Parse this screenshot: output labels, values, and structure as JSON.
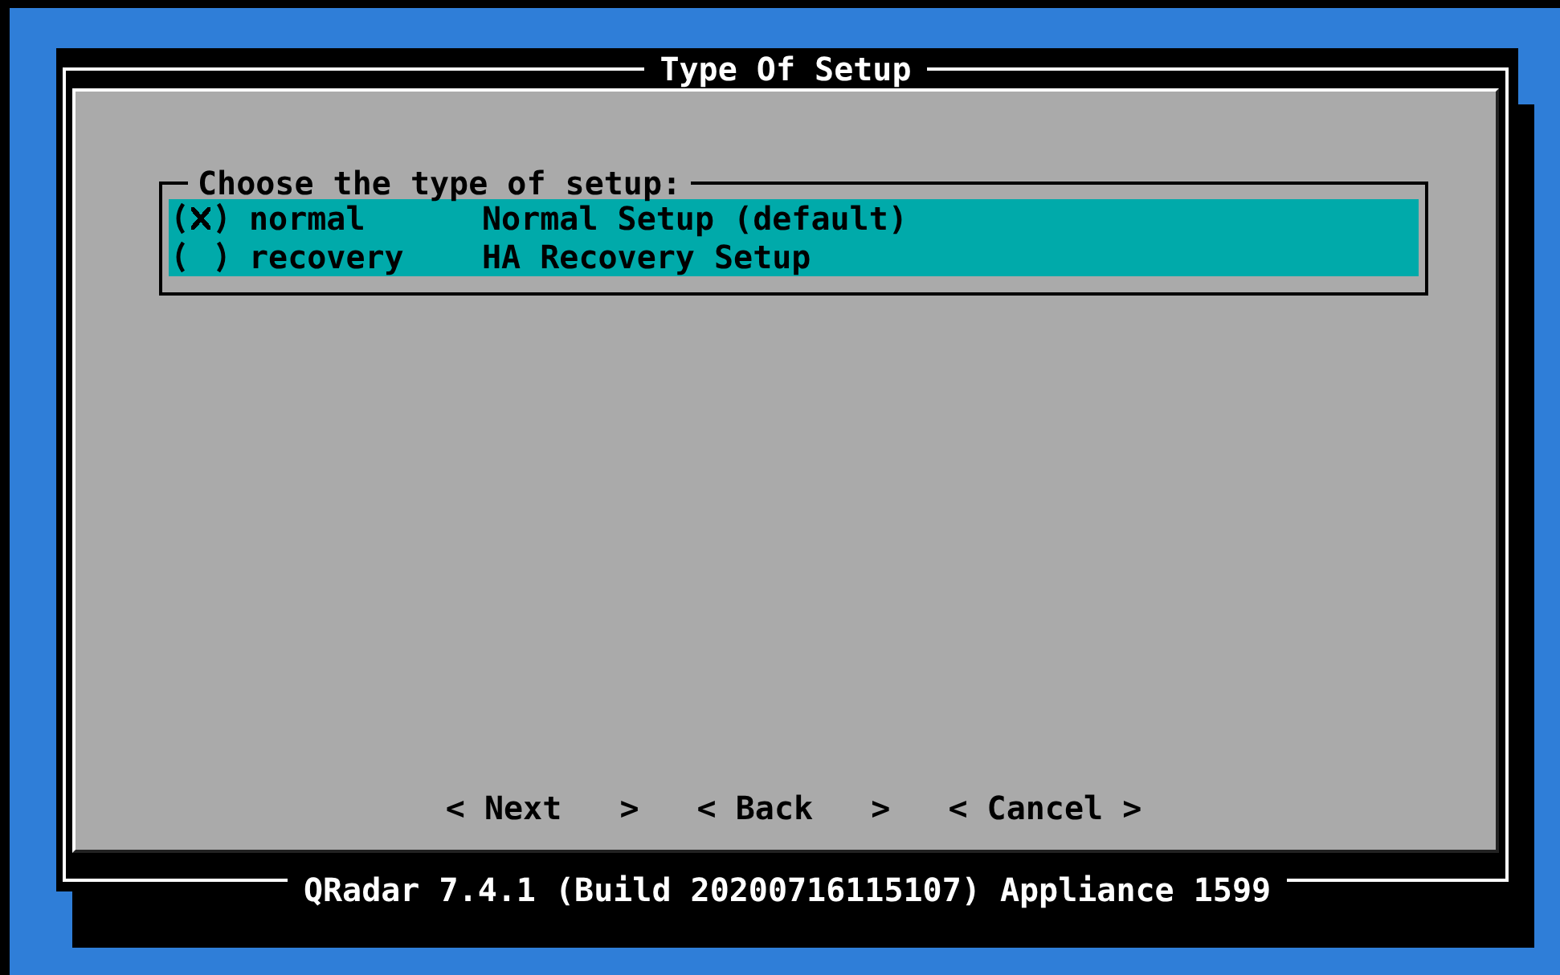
{
  "dialog": {
    "title": "Type Of Setup",
    "footer": "QRadar 7.4.1 (Build 20200716115107) Appliance 1599"
  },
  "group": {
    "label": "Choose the type of setup:",
    "options": [
      {
        "tag": "normal",
        "description": "Normal Setup (default)",
        "selected": true
      },
      {
        "tag": "recovery",
        "description": "HA Recovery Setup",
        "selected": false
      }
    ]
  },
  "buttons": [
    {
      "label": "< Next   >"
    },
    {
      "label": "< Back   >"
    },
    {
      "label": "< Cancel >"
    }
  ]
}
